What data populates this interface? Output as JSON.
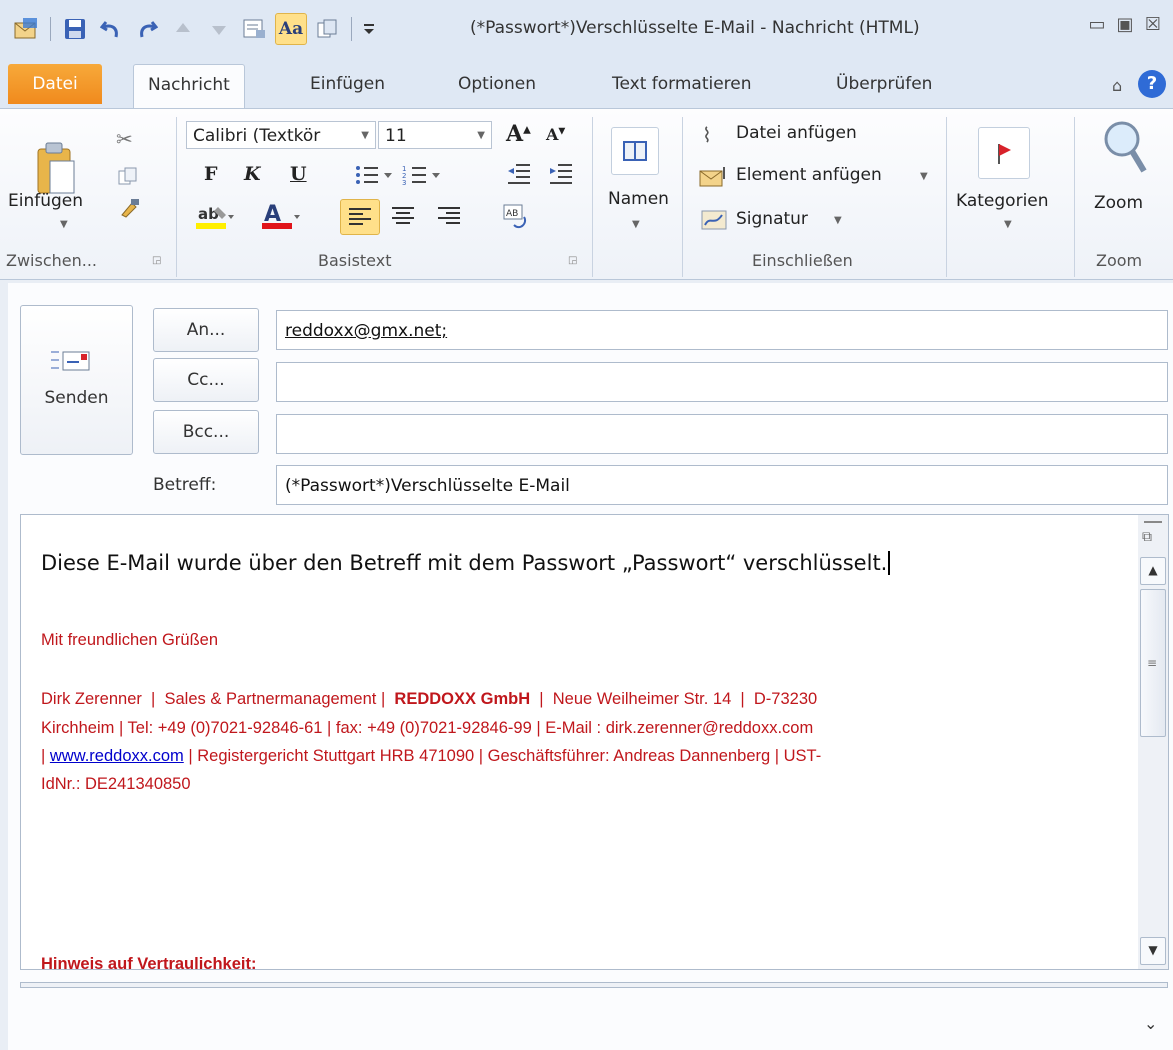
{
  "window": {
    "title": "(*Passwort*)Verschlüsselte E-Mail  -  Nachricht (HTML)"
  },
  "tabs": [
    {
      "label": "Datei"
    },
    {
      "label": "Nachricht"
    },
    {
      "label": "Einfügen"
    },
    {
      "label": "Optionen"
    },
    {
      "label": "Text formatieren"
    },
    {
      "label": "Überprüfen"
    }
  ],
  "ribbon": {
    "clipboard": {
      "paste_label": "Einfügen",
      "group_label": "Zwischen..."
    },
    "basictext": {
      "font_name": "Calibri (Textkör",
      "font_size": "11",
      "bold": "F",
      "italic": "K",
      "underline": "U",
      "group_label": "Basistext"
    },
    "names": {
      "label": "Namen"
    },
    "include": {
      "attach_file": "Datei anfügen",
      "attach_item": "Element anfügen",
      "signature": "Signatur",
      "group_label": "Einschließen"
    },
    "tags": {
      "categories": "Kategorien"
    },
    "zoom": {
      "label": "Zoom",
      "group_label": "Zoom"
    }
  },
  "compose": {
    "send_label": "Senden",
    "to_button": "An...",
    "cc_button": "Cc...",
    "bcc_button": "Bcc...",
    "subject_label": "Betreff:",
    "to_value": "reddoxx@gmx.net;",
    "cc_value": "",
    "bcc_value": "",
    "subject_value": "(*Passwort*)Verschlüsselte E-Mail"
  },
  "body": {
    "intro": "Diese E-Mail wurde über den Betreff mit dem Passwort „Passwort“ verschlüsselt.",
    "greeting": "Mit freundlichen Grüßen",
    "sig_name": "Dirk Zerenner",
    "sig_dept": "Sales & Partnermanagement |",
    "sig_company": "REDDOXX GmbH",
    "sig_address": "Neue Weilheimer Str. 14",
    "sig_zip": "D-73230",
    "sig_line2": "Kirchheim |  Tel: +49 (0)7021-92846-61    | fax: +49 (0)7021-92846-99  | E-Mail : dirk.zerenner@reddoxx.com",
    "sig_link": "www.reddoxx.com",
    "sig_line3_rest": " |  Registergericht Stuttgart HRB 471090 |  Geschäftsführer: Andreas Dannenberg  |  UST-",
    "sig_line4": "IdNr.: DE241340850",
    "notice_heading": "Hinweis auf Vertraulichkeit:"
  },
  "colors": {
    "accent": "#f08a1d",
    "signature_red": "#c0171c",
    "link": "#0000cc"
  }
}
